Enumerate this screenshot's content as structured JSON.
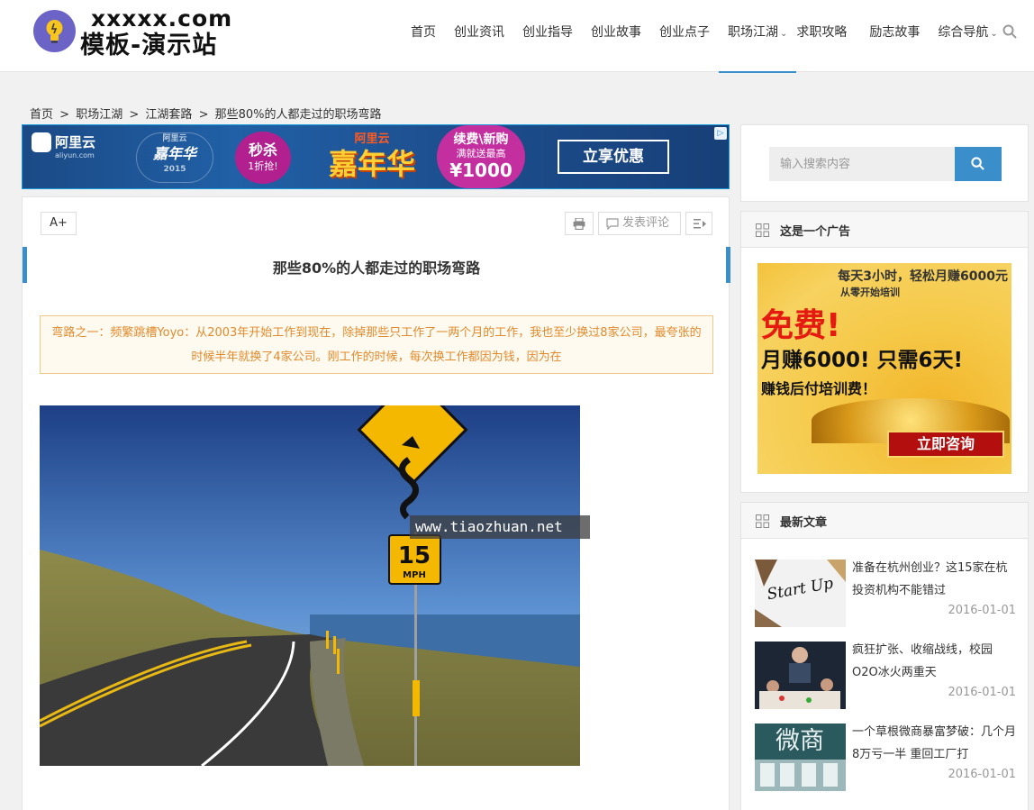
{
  "logo": {
    "line1": "xxxxx.com",
    "line2": "模板-演示站"
  },
  "nav": {
    "items": [
      {
        "label": "首页",
        "caret": false
      },
      {
        "label": "创业资讯",
        "caret": false
      },
      {
        "label": "创业指导",
        "caret": false
      },
      {
        "label": "创业故事",
        "caret": false
      },
      {
        "label": "创业点子",
        "caret": false
      },
      {
        "label": "职场江湖",
        "caret": true,
        "active": true
      },
      {
        "label": "求职攻略",
        "caret": false
      },
      {
        "label": "励志故事",
        "caret": false
      },
      {
        "label": "综合导航",
        "caret": true
      }
    ],
    "search_icon": "search-icon"
  },
  "breadcrumb": {
    "home": "首页",
    "sep": ">",
    "cat": "职场江湖",
    "sub": "江湖套路",
    "current": "那些80%的人都走过的职场弯路"
  },
  "banner": {
    "brand": "阿里云",
    "brand_domain": "aliyun.com",
    "badge_title": "嘉年华",
    "badge_top": "阿里云",
    "badge_year": "2015",
    "sale": "秒杀",
    "sale_sub": "1折抢!",
    "main_top": "阿里云",
    "main": "嘉年华",
    "offer_l1": "续费\\新购",
    "offer_l2": "满就送最高",
    "offer_l3": "¥1000",
    "button": "立享优惠"
  },
  "article": {
    "font_button": "A+",
    "comment_button": "发表评论",
    "title": "那些80%的人都走过的职场弯路",
    "summary": "弯路之一：频繁跳槽Yoyo：从2003年开始工作到现在，除掉那些只工作了一两个月的工作，我也至少换过8家公司，最夸张的时候半年就换了4家公司。刚工作的时候，每次换工作都因为钱，因为在",
    "sign_speed": "15",
    "sign_unit": "MPH",
    "watermark": "www.tiaozhuan.net"
  },
  "sidebar": {
    "search_placeholder": "输入搜索内容",
    "ad_widget_title": "这是一个广告",
    "ad": {
      "l1": "每天3小时，轻松月赚6000元",
      "l2": "从零开始培训",
      "l3": "免费!",
      "l4": "月赚6000! 只需6天!",
      "l5": "赚钱后付培训费！",
      "button": "立即咨询"
    },
    "latest_title": "最新文章",
    "posts": [
      {
        "title": "准备在杭州创业？这15家在杭投资机构不能错过",
        "date": "2016-01-01",
        "thumb_text": "Start Up"
      },
      {
        "title": "疯狂扩张、收缩战线，校园O2O冰火两重天",
        "date": "2016-01-01",
        "thumb_text": ""
      },
      {
        "title": "一个草根微商暴富梦破：几个月8万亏一半 重回工厂打",
        "date": "2016-01-01",
        "thumb_text": "微商"
      }
    ]
  },
  "colors": {
    "accent": "#3a8ec9",
    "summary_text": "#e08a2c",
    "summary_border": "#f0c78a"
  }
}
